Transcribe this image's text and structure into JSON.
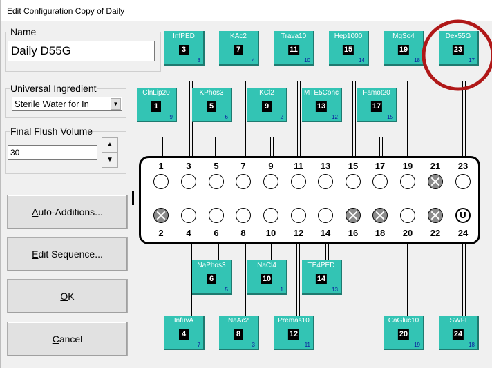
{
  "window": {
    "title": "Edit Configuration Copy of Daily"
  },
  "name_group": {
    "label": "Name",
    "value": "Daily D55G"
  },
  "ingredient_group": {
    "label": "Universal Ingredient",
    "value": "Sterile Water for In"
  },
  "flush_group": {
    "label": "Final Flush Volume",
    "value": "30"
  },
  "buttons": {
    "auto_additions": {
      "text": "Auto-Additions...",
      "mnemonic": "A",
      "rest": "uto-Additions..."
    },
    "edit_sequence": {
      "mnemonic": "E",
      "rest": "dit Sequence..."
    },
    "ok": {
      "mnemonic": "O",
      "rest": "K"
    },
    "cancel": {
      "mnemonic": "C",
      "rest": "ancel"
    }
  },
  "tiles": [
    {
      "name": "InfPED",
      "port": "3",
      "count": "8"
    },
    {
      "name": "KAc2",
      "port": "7",
      "count": "4"
    },
    {
      "name": "Trava10",
      "port": "11",
      "count": "10"
    },
    {
      "name": "Hep1000",
      "port": "15",
      "count": "14"
    },
    {
      "name": "MgSo4",
      "port": "19",
      "count": "18"
    },
    {
      "name": "Dex55G",
      "port": "23",
      "count": "17"
    },
    {
      "name": "ClnLip20",
      "port": "1",
      "count": "9"
    },
    {
      "name": "KPhos3",
      "port": "5",
      "count": "6"
    },
    {
      "name": "KCl2",
      "port": "9",
      "count": "2"
    },
    {
      "name": "MTE5Conc",
      "port": "13",
      "count": "12"
    },
    {
      "name": "Famot20",
      "port": "17",
      "count": "15"
    },
    {
      "name": "NaPhos3",
      "port": "6",
      "count": "5"
    },
    {
      "name": "NaCl4",
      "port": "10",
      "count": "1"
    },
    {
      "name": "TE4PED",
      "port": "14",
      "count": "13"
    },
    {
      "name": "InfuvA",
      "port": "4",
      "count": "7"
    },
    {
      "name": "NaAc2",
      "port": "8",
      "count": "3"
    },
    {
      "name": "Premas10",
      "port": "12",
      "count": "11"
    },
    {
      "name": "CaGluc10",
      "port": "20",
      "count": "19"
    },
    {
      "name": "SWFI",
      "port": "24",
      "count": "18"
    }
  ],
  "manifold": {
    "top_ports": [
      "1",
      "3",
      "5",
      "7",
      "9",
      "11",
      "13",
      "15",
      "17",
      "19",
      "21",
      "23"
    ],
    "bottom_ports": [
      "2",
      "4",
      "6",
      "8",
      "10",
      "12",
      "14",
      "16",
      "18",
      "20",
      "22",
      "24"
    ],
    "top_states": [
      "open",
      "open",
      "open",
      "open",
      "open",
      "open",
      "open",
      "open",
      "open",
      "open",
      "x",
      "open"
    ],
    "bottom_states": [
      "x",
      "open",
      "open",
      "open",
      "open",
      "open",
      "open",
      "x",
      "x",
      "open",
      "x",
      "u"
    ],
    "u_symbol": "U"
  },
  "colors": {
    "tile": "#33c4b4",
    "tile_count": "#0a1a9e",
    "highlight": "#b01818"
  }
}
